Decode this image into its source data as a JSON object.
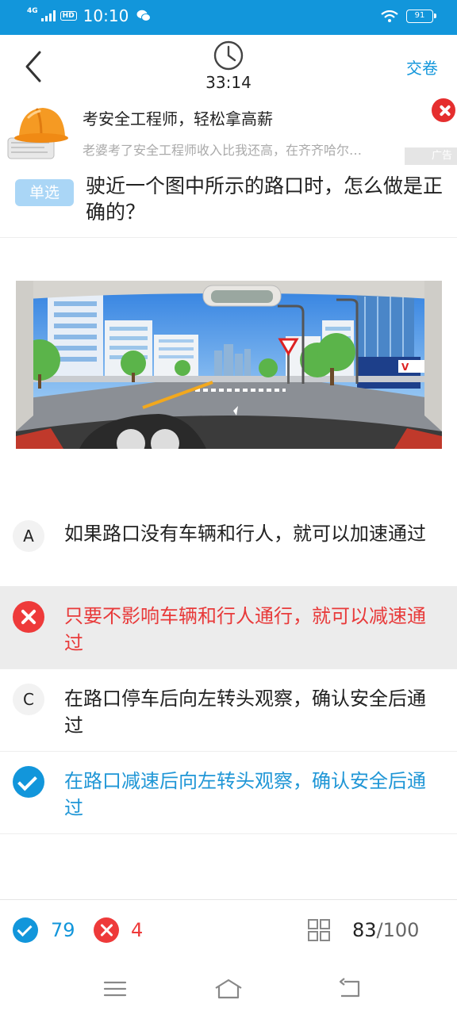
{
  "status_bar": {
    "network": "4G",
    "hd": "HD",
    "time": "10:10",
    "battery": "91"
  },
  "header": {
    "timer": "33:14",
    "submit_label": "交卷"
  },
  "ad": {
    "title": "考安全工程师，轻松拿高薪",
    "description": "老婆考了安全工程师收入比我还高，在齐齐哈尔…",
    "badge": "广告"
  },
  "question": {
    "type_label": "单选",
    "text": "驶近一个图中所示的路口时，怎么做是正确的？"
  },
  "options": [
    {
      "key": "A",
      "text": "如果路口没有车辆和行人，就可以加速通过",
      "state": "normal"
    },
    {
      "key": "B",
      "text": "只要不影响车辆和行人通行，就可以减速通过",
      "state": "wrong"
    },
    {
      "key": "C",
      "text": "在路口停车后向左转头观察，确认安全后通过",
      "state": "normal"
    },
    {
      "key": "D",
      "text": "在路口减速后向左转头观察，确认安全后通过",
      "state": "correct"
    }
  ],
  "footer": {
    "correct_count": "79",
    "wrong_count": "4",
    "current": "83",
    "total": "/100"
  },
  "colors": {
    "accent": "#1296db",
    "wrong": "#ee3a3a",
    "status_bar": "#1296db"
  },
  "icons": [
    "back-icon",
    "clock-icon",
    "close-icon",
    "grid-icon",
    "menu-icon",
    "home-icon",
    "return-icon"
  ]
}
